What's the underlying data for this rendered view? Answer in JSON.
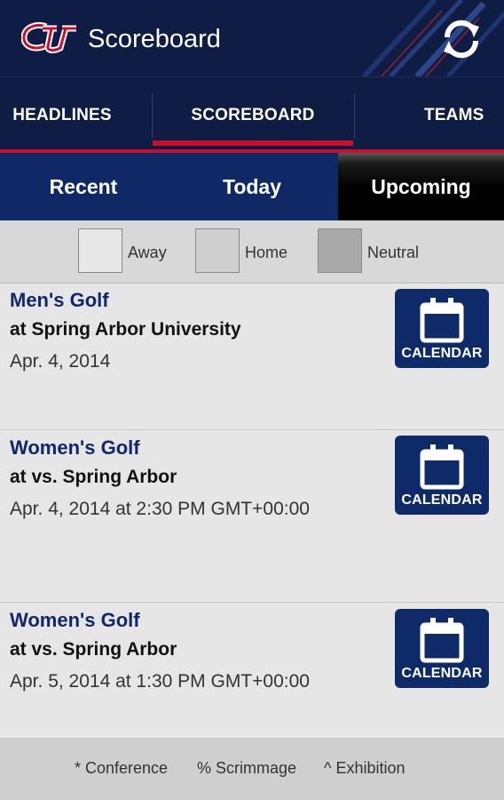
{
  "app": {
    "title": "Scoreboard",
    "logo_icon": "cu-logo-icon",
    "refresh_icon": "refresh-icon"
  },
  "section_tabs": [
    {
      "label": "HEADLINES",
      "selected": false
    },
    {
      "label": "SCOREBOARD",
      "selected": true
    },
    {
      "label": "TEAMS",
      "selected": false
    }
  ],
  "sub_tabs": [
    {
      "label": "Recent",
      "selected": false
    },
    {
      "label": "Today",
      "selected": false
    },
    {
      "label": "Upcoming",
      "selected": true
    }
  ],
  "legend": [
    {
      "label": "Away",
      "color": "#e8e8e8"
    },
    {
      "label": "Home",
      "color": "#cfcfcf"
    },
    {
      "label": "Neutral",
      "color": "#a9a9a9"
    }
  ],
  "events": [
    {
      "sport": "Men's Golf",
      "opponent": "at Spring Arbor University",
      "date": "Apr. 4, 2014",
      "calendar_label": "CALENDAR"
    },
    {
      "sport": "Women's Golf",
      "opponent": "at vs. Spring Arbor",
      "date": "Apr. 4, 2014 at 2:30 PM GMT+00:00",
      "calendar_label": "CALENDAR"
    },
    {
      "sport": "Women's Golf",
      "opponent": "at vs. Spring Arbor",
      "date": "Apr. 5, 2014 at 1:30 PM GMT+00:00",
      "calendar_label": "CALENDAR"
    }
  ],
  "footer": [
    {
      "label": "* Conference"
    },
    {
      "label": "% Scrimmage"
    },
    {
      "label": "^ Exhibition"
    }
  ],
  "colors": {
    "navy": "#0f1d44",
    "accent_red": "#c8102e",
    "tab_blue": "#0e2966",
    "calendar_blue": "#0f2a68"
  }
}
